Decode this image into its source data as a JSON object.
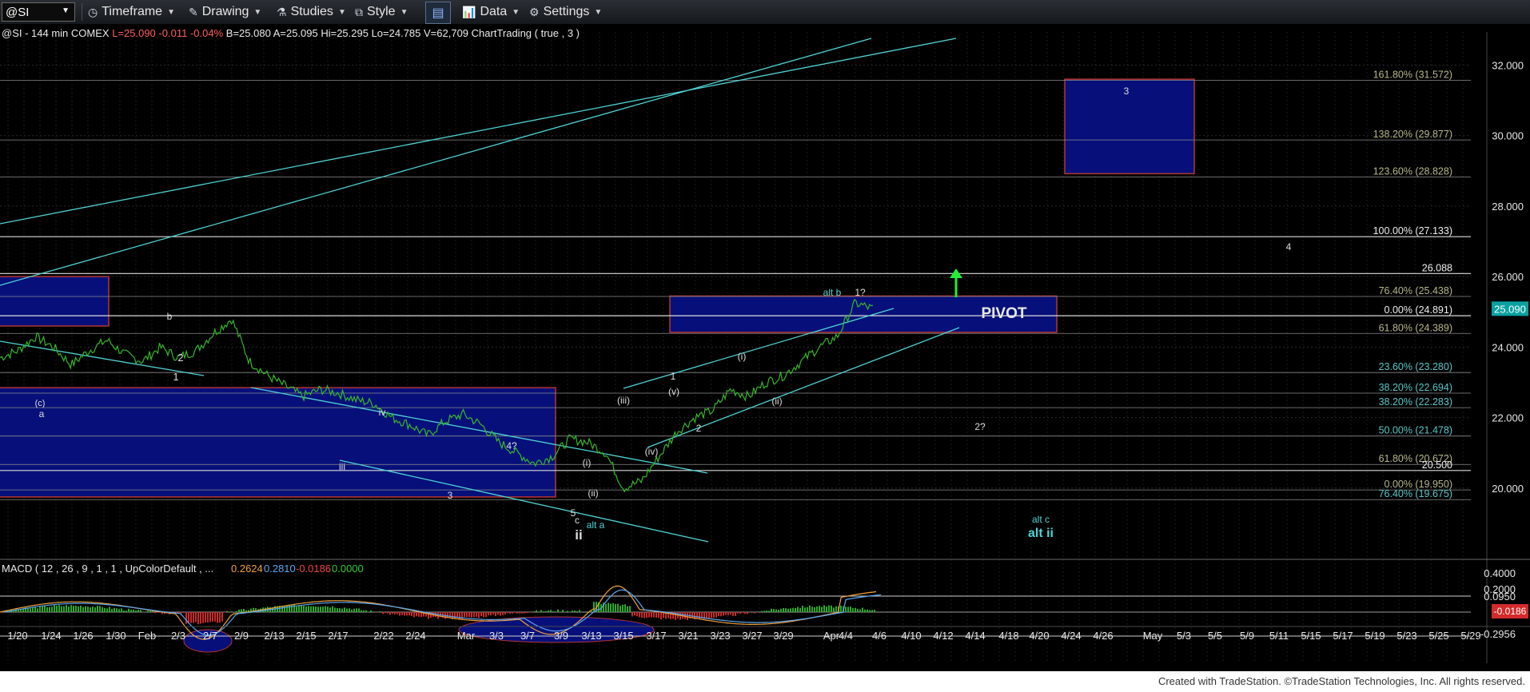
{
  "toolbar": {
    "symbol": "@SI",
    "timeframe": "Timeframe",
    "drawing": "Drawing",
    "studies": "Studies",
    "style": "Style",
    "data": "Data",
    "settings": "Settings",
    "icons": [
      "clock-icon",
      "pencil-icon",
      "flask-icon",
      "style-icon",
      "panels-icon",
      "bar-chart-icon",
      "gear-icon"
    ]
  },
  "info_line": {
    "prefix": "@SI - 144 min  COMEX",
    "last": "L=25.090",
    "chg": "-0.011",
    "pct": "-0.04%",
    "rest": "B=25.080  A=25.095  Hi=25.295  Lo=24.785  V=62,709  ChartTrading ( true , 3 )"
  },
  "macd_label": {
    "prefix": "MACD ( 12 , 26 , 9 , 1 , 1 , UpColorDefault , ...",
    "v1": "0.2624",
    "v2": "0.2810",
    "v3": "-0.0186",
    "v4": "0.0000"
  },
  "colors": {
    "price": "#35b82a",
    "cyan": "#4fd3d3",
    "box_fill": "#07107a",
    "box_border": "#b53434",
    "axis_text": "#e8e8e8",
    "price_box": "#0aa1a1",
    "macd_neg_box": "#d42a2a",
    "fib_text": "#b8b88a",
    "fib_text_teal": "#58c8c8",
    "arrow": "#22ee33"
  },
  "chart_data": {
    "type": "line",
    "series": [
      {
        "values": [
          23.7,
          23.9,
          24.3,
          24.0,
          23.5,
          23.9,
          24.2,
          23.8,
          23.6,
          24.0,
          23.7,
          23.9,
          24.4,
          24.8,
          23.6,
          23.2,
          22.9,
          22.6,
          22.8,
          22.7,
          22.5,
          22.4,
          22.0,
          21.8,
          21.5,
          21.9,
          22.1,
          21.8,
          21.3,
          21.0,
          20.7,
          20.9,
          21.4,
          21.3,
          21.0,
          20.0,
          20.2,
          20.9,
          21.6,
          22.0,
          22.2,
          22.8,
          22.6,
          23.0,
          23.2,
          23.6,
          24.0,
          24.3,
          25.25,
          25.09
        ]
      },
      {
        "name": "MACD"
      }
    ],
    "y_axis": {
      "ticks": [
        "32.000",
        "30.000",
        "28.000",
        "26.000",
        "24.000",
        "22.000",
        "20.000"
      ],
      "range": [
        19.0,
        32.6
      ]
    },
    "current_price": "25.090",
    "macd_axis": {
      "ticks": [
        "0.4000",
        "0.2000",
        "0.0950",
        "-0.2956"
      ],
      "current": "-0.0186"
    },
    "x_labels": [
      "1/20",
      "1/24",
      "1/26",
      "1/30",
      "Feb",
      "2/3",
      "2/7",
      "2/9",
      "2/13",
      "2/15",
      "2/17",
      "2/22",
      "2/24",
      "Mar",
      "3/3",
      "3/7",
      "3/9",
      "3/13",
      "3/15",
      "3/17",
      "3/21",
      "3/23",
      "3/27",
      "3/29",
      "Apr",
      "4/4",
      "4/6",
      "4/10",
      "4/12",
      "4/14",
      "4/18",
      "4/20",
      "4/24",
      "4/26",
      "May",
      "5/3",
      "5/5",
      "5/9",
      "5/11",
      "5/15",
      "5/17",
      "5/19",
      "5/23",
      "5/25",
      "5/29"
    ],
    "fib_levels": [
      {
        "label": "161.80% (31.572)",
        "y": 31.572
      },
      {
        "label": "138.20% (29.877)",
        "y": 29.877
      },
      {
        "label": "123.60% (28.828)",
        "y": 28.828
      },
      {
        "label": "100.00% (27.133)",
        "y": 27.133
      },
      {
        "label": "26.088",
        "y": 26.088
      },
      {
        "label": "76.40% (25.438)",
        "y": 25.438
      },
      {
        "label": "0.00% (24.891)",
        "y": 24.891
      },
      {
        "label": "61.80% (24.389)",
        "y": 24.389
      },
      {
        "label": "23.60% (23.280)",
        "y": 23.28
      },
      {
        "label": "38.20% (22.694)",
        "y": 22.694
      },
      {
        "label": "38.20% (22.283)",
        "y": 22.283
      },
      {
        "label": "50.00% (21.478)",
        "y": 21.478
      },
      {
        "label": "61.80% (20.672)",
        "y": 20.672
      },
      {
        "label": "20.500",
        "y": 20.5
      },
      {
        "label": "0.00% (19.950)",
        "y": 19.95
      },
      {
        "label": "76.40% (19.675)",
        "y": 19.675
      }
    ],
    "annotations": [
      "(c)",
      "a",
      "b",
      "2",
      "1",
      "iv",
      "iii",
      "4?",
      "3",
      "5",
      "c",
      "ii",
      "(i)",
      "(ii)",
      "(iii)",
      "(iv)",
      "(v)",
      "1",
      "2",
      "(i)",
      "(ii)",
      "alt a",
      "alt b",
      "1?",
      "PIVOT",
      "3",
      "4",
      "2?",
      "alt c",
      "alt ii"
    ]
  },
  "footer": {
    "text": "Created with TradeStation. ©TradeStation Technologies, Inc. All rights reserved."
  }
}
